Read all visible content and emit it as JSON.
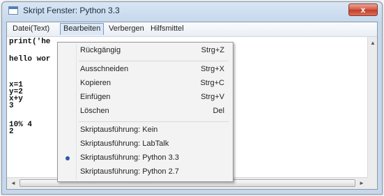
{
  "window": {
    "title": "Skript Fenster: Python 3.3",
    "close_label": "x"
  },
  "menubar": {
    "items": [
      {
        "label": "Datei(Text)"
      },
      {
        "label": "Bearbeiten"
      },
      {
        "label": "Verbergen"
      },
      {
        "label": "Hilfsmittel"
      }
    ]
  },
  "editor": {
    "lines": [
      "print('he",
      "hello wor",
      "x=1",
      "y=2",
      "x+y",
      "3",
      "10% 4",
      "2"
    ]
  },
  "dropdown": {
    "items": [
      {
        "label": "Rückgängig",
        "shortcut": "Strg+Z"
      },
      {
        "label": "Ausschneiden",
        "shortcut": "Strg+X"
      },
      {
        "label": "Kopieren",
        "shortcut": "Strg+C"
      },
      {
        "label": "Einfügen",
        "shortcut": "Strg+V"
      },
      {
        "label": "Löschen",
        "shortcut": "Del"
      },
      {
        "label": "Skriptausführung: Kein"
      },
      {
        "label": "Skriptausführung: LabTalk"
      },
      {
        "label": "Skriptausführung: Python 3.3",
        "checked": true
      },
      {
        "label": "Skriptausführung: Python 2.7"
      }
    ]
  },
  "scroll": {
    "up_icon": "▲",
    "left_icon": "◄",
    "right_icon": "►"
  }
}
